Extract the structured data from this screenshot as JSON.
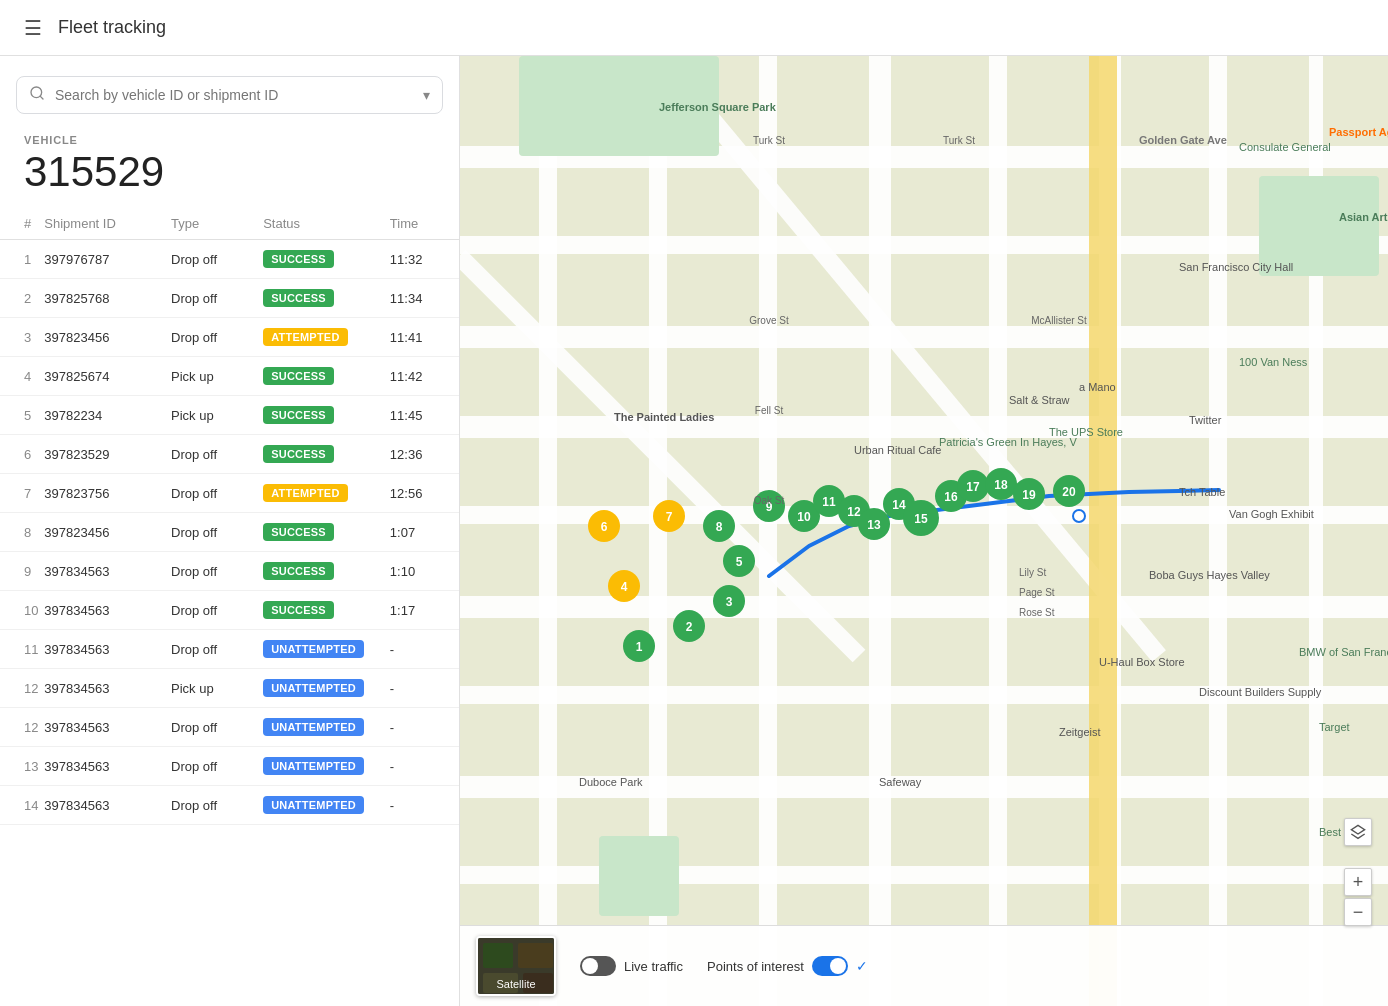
{
  "header": {
    "menu_icon": "☰",
    "title": "Fleet tracking"
  },
  "search": {
    "placeholder": "Search by vehicle ID or shipment ID"
  },
  "vehicle": {
    "label": "VEHICLE",
    "id": "315529"
  },
  "table": {
    "columns": [
      "#",
      "Shipment ID",
      "Type",
      "Status",
      "Time"
    ],
    "rows": [
      {
        "num": 1,
        "shipment_id": "397976787",
        "type": "Drop off",
        "status": "SUCCESS",
        "status_class": "badge-success",
        "time": "11:32"
      },
      {
        "num": 2,
        "shipment_id": "397825768",
        "type": "Drop off",
        "status": "SUCCESS",
        "status_class": "badge-success",
        "time": "11:34"
      },
      {
        "num": 3,
        "shipment_id": "397823456",
        "type": "Drop off",
        "status": "ATTEMPTED",
        "status_class": "badge-attempted",
        "time": "11:41"
      },
      {
        "num": 4,
        "shipment_id": "397825674",
        "type": "Pick up",
        "status": "SUCCESS",
        "status_class": "badge-success",
        "time": "11:42"
      },
      {
        "num": 5,
        "shipment_id": "39782234",
        "type": "Pick up",
        "status": "SUCCESS",
        "status_class": "badge-success",
        "time": "11:45"
      },
      {
        "num": 6,
        "shipment_id": "397823529",
        "type": "Drop off",
        "status": "SUCCESS",
        "status_class": "badge-success",
        "time": "12:36"
      },
      {
        "num": 7,
        "shipment_id": "397823756",
        "type": "Drop off",
        "status": "ATTEMPTED",
        "status_class": "badge-attempted",
        "time": "12:56"
      },
      {
        "num": 8,
        "shipment_id": "397823456",
        "type": "Drop off",
        "status": "SUCCESS",
        "status_class": "badge-success",
        "time": "1:07"
      },
      {
        "num": 9,
        "shipment_id": "397834563",
        "type": "Drop off",
        "status": "SUCCESS",
        "status_class": "badge-success",
        "time": "1:10"
      },
      {
        "num": 10,
        "shipment_id": "397834563",
        "type": "Drop off",
        "status": "SUCCESS",
        "status_class": "badge-success",
        "time": "1:17"
      },
      {
        "num": 11,
        "shipment_id": "397834563",
        "type": "Drop off",
        "status": "UNATTEMPTED",
        "status_class": "badge-unattempted",
        "time": "-"
      },
      {
        "num": 12,
        "shipment_id": "397834563",
        "type": "Pick up",
        "status": "UNATTEMPTED",
        "status_class": "badge-unattempted",
        "time": "-"
      },
      {
        "num": 12,
        "shipment_id": "397834563",
        "type": "Drop off",
        "status": "UNATTEMPTED",
        "status_class": "badge-unattempted",
        "time": "-"
      },
      {
        "num": 13,
        "shipment_id": "397834563",
        "type": "Drop off",
        "status": "UNATTEMPTED",
        "status_class": "badge-unattempted",
        "time": "-"
      },
      {
        "num": 14,
        "shipment_id": "397834563",
        "type": "Drop off",
        "status": "UNATTEMPTED",
        "status_class": "badge-unattempted",
        "time": "-"
      }
    ]
  },
  "map": {
    "live_traffic_label": "Live traffic",
    "points_of_interest_label": "Points of interest",
    "satellite_label": "Satellite",
    "zoom_in": "+",
    "zoom_out": "−"
  }
}
